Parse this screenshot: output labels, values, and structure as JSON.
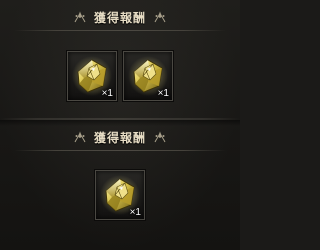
{
  "panels": [
    {
      "title": "獲得報酬",
      "rewards": [
        {
          "icon": "gold-gem-crystal-icon",
          "quantity": "×1"
        },
        {
          "icon": "gold-gem-crystal-icon",
          "quantity": "×1"
        }
      ]
    },
    {
      "title": "獲得報酬",
      "rewards": [
        {
          "icon": "gold-gem-crystal-icon",
          "quantity": "×1"
        }
      ]
    }
  ],
  "colors": {
    "title_text": "#e6dcc4",
    "background": "#1b1a18",
    "gem_gold": "#d8c24a",
    "slot_border": "#4a4842"
  }
}
